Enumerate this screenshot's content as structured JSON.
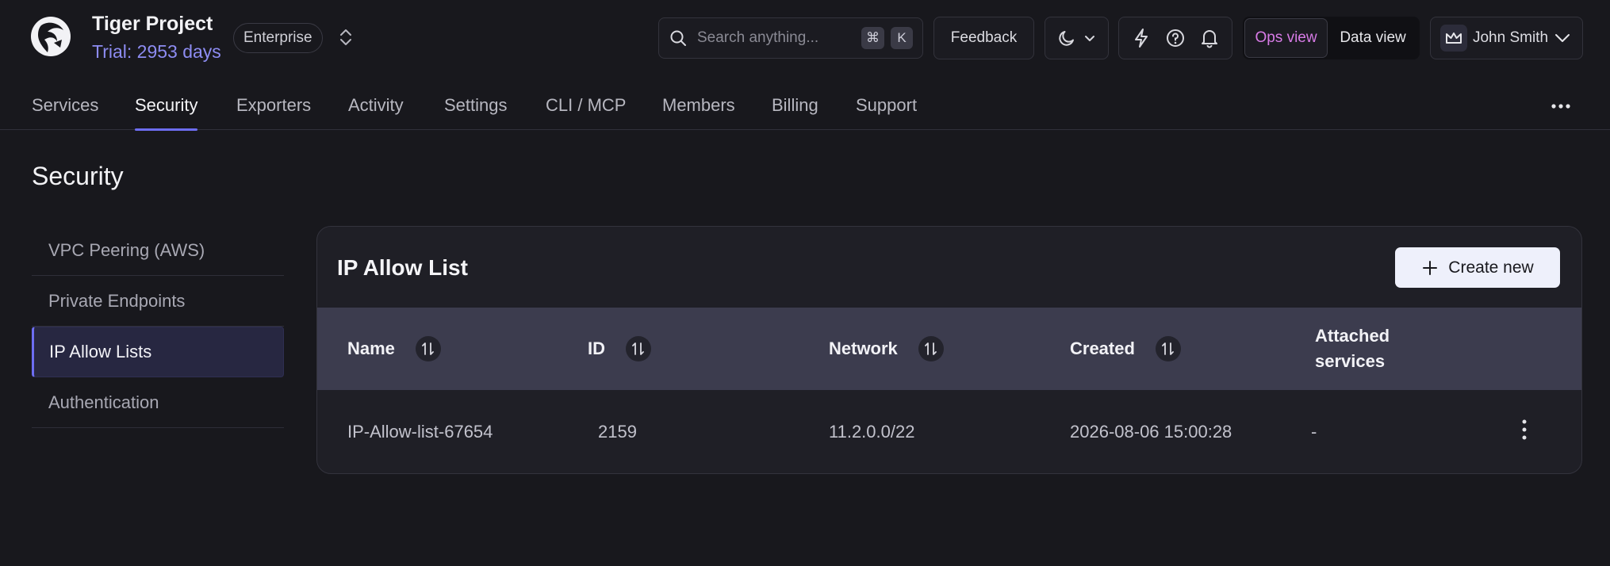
{
  "header": {
    "project_name": "Tiger Project",
    "trial_text": "Trial: 2953 days",
    "plan_badge": "Enterprise",
    "search": {
      "placeholder": "Search anything...",
      "kbd_modifier": "⌘",
      "kbd_key": "K"
    },
    "feedback_label": "Feedback",
    "view_toggle": {
      "ops_label": "Ops view",
      "data_label": "Data view",
      "active": "ops"
    },
    "user_name": "John Smith"
  },
  "nav": {
    "tabs": [
      {
        "label": "Services"
      },
      {
        "label": "Security",
        "active": true
      },
      {
        "label": "Exporters"
      },
      {
        "label": "Activity"
      },
      {
        "label": "Settings"
      },
      {
        "label": "CLI / MCP"
      },
      {
        "label": "Members"
      },
      {
        "label": "Billing"
      },
      {
        "label": "Support"
      }
    ]
  },
  "page": {
    "title": "Security"
  },
  "sidebar": {
    "items": [
      {
        "label": "VPC Peering (AWS)"
      },
      {
        "label": "Private Endpoints"
      },
      {
        "label": "IP Allow Lists",
        "active": true
      },
      {
        "label": "Authentication"
      }
    ]
  },
  "card": {
    "title": "IP Allow List",
    "create_label": "Create new",
    "columns": [
      "Name",
      "ID",
      "Network",
      "Created",
      "Attached services"
    ],
    "rows": [
      {
        "name": "IP-Allow-list-67654",
        "id": "2159",
        "network": "11.2.0.0/22",
        "created": "2026-08-06 15:00:28",
        "attached": "-"
      }
    ]
  },
  "colors": {
    "background": "#18181d",
    "accent": "#6d6df2",
    "trial": "#8d8cf2",
    "ops_view": "#d77be6",
    "table_header": "#3c3c4e"
  }
}
